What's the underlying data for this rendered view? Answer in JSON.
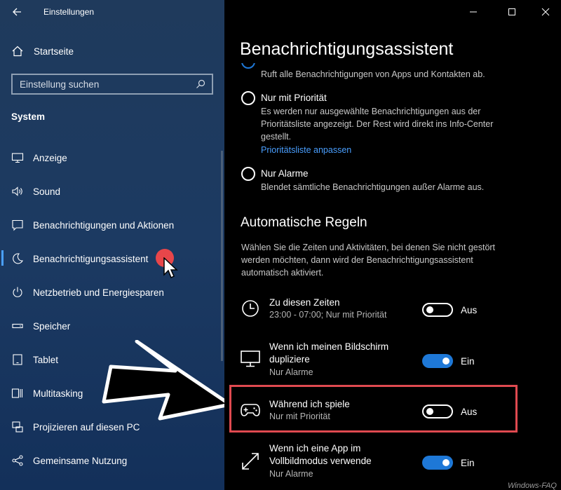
{
  "app": {
    "title": "Einstellungen"
  },
  "sidebar": {
    "home_label": "Startseite",
    "search_placeholder": "Einstellung suchen",
    "section_title": "System",
    "items": [
      {
        "label": "Anzeige",
        "icon": "display-icon"
      },
      {
        "label": "Sound",
        "icon": "speaker-icon"
      },
      {
        "label": "Benachrichtigungen und Aktionen",
        "icon": "notification-icon"
      },
      {
        "label": "Benachrichtigungsassistent",
        "icon": "moon-icon",
        "active": true
      },
      {
        "label": "Netzbetrieb und Energiesparen",
        "icon": "power-icon"
      },
      {
        "label": "Speicher",
        "icon": "storage-icon"
      },
      {
        "label": "Tablet",
        "icon": "tablet-icon"
      },
      {
        "label": "Multitasking",
        "icon": "multitasking-icon"
      },
      {
        "label": "Projizieren auf diesen PC",
        "icon": "project-icon"
      },
      {
        "label": "Gemeinsame Nutzung",
        "icon": "share-icon"
      }
    ]
  },
  "main": {
    "page_title": "Benachrichtigungsassistent",
    "partial_option_desc": "Ruft alle Benachrichtigungen von Apps und Kontakten ab.",
    "options": [
      {
        "label": "Nur mit Priorität",
        "desc_lines": [
          "Es werden nur ausgewählte Benachrichtigungen aus der",
          "Prioritätsliste angezeigt. Der Rest wird direkt ins Info-Center",
          "gestellt."
        ],
        "link": "Prioritätsliste anpassen"
      },
      {
        "label": "Nur Alarme",
        "desc_lines": [
          "Blendet sämtliche Benachrichtigungen außer Alarme aus."
        ]
      }
    ],
    "rules_title": "Automatische Regeln",
    "rules_desc_lines": [
      "Wählen Sie die Zeiten und Aktivitäten, bei denen Sie nicht gestört",
      "werden möchten, dann wird der Benachrichtigungsassistent",
      "automatisch aktiviert."
    ],
    "rules": [
      {
        "title_lines": [
          "Zu diesen Zeiten"
        ],
        "sub": "23:00 - 07:00; Nur mit Priorität",
        "state": "Aus",
        "on": false,
        "icon": "clock-icon"
      },
      {
        "title_lines": [
          "Wenn ich meinen Bildschirm",
          "dupliziere"
        ],
        "sub": "Nur Alarme",
        "state": "Ein",
        "on": true,
        "icon": "monitor-icon"
      },
      {
        "title_lines": [
          "Während ich spiele"
        ],
        "sub": "Nur mit Priorität",
        "state": "Aus",
        "on": false,
        "icon": "gamepad-icon"
      },
      {
        "title_lines": [
          "Wenn ich eine App im",
          "Vollbildmodus verwende"
        ],
        "sub": "Nur Alarme",
        "state": "Ein",
        "on": true,
        "icon": "fullscreen-icon"
      }
    ]
  },
  "colors": {
    "accent": "#1e78d7",
    "link": "#4a9fff",
    "highlight": "#e04a50",
    "sidebar": "#1c3a62"
  },
  "watermark": "Windows-FAQ"
}
